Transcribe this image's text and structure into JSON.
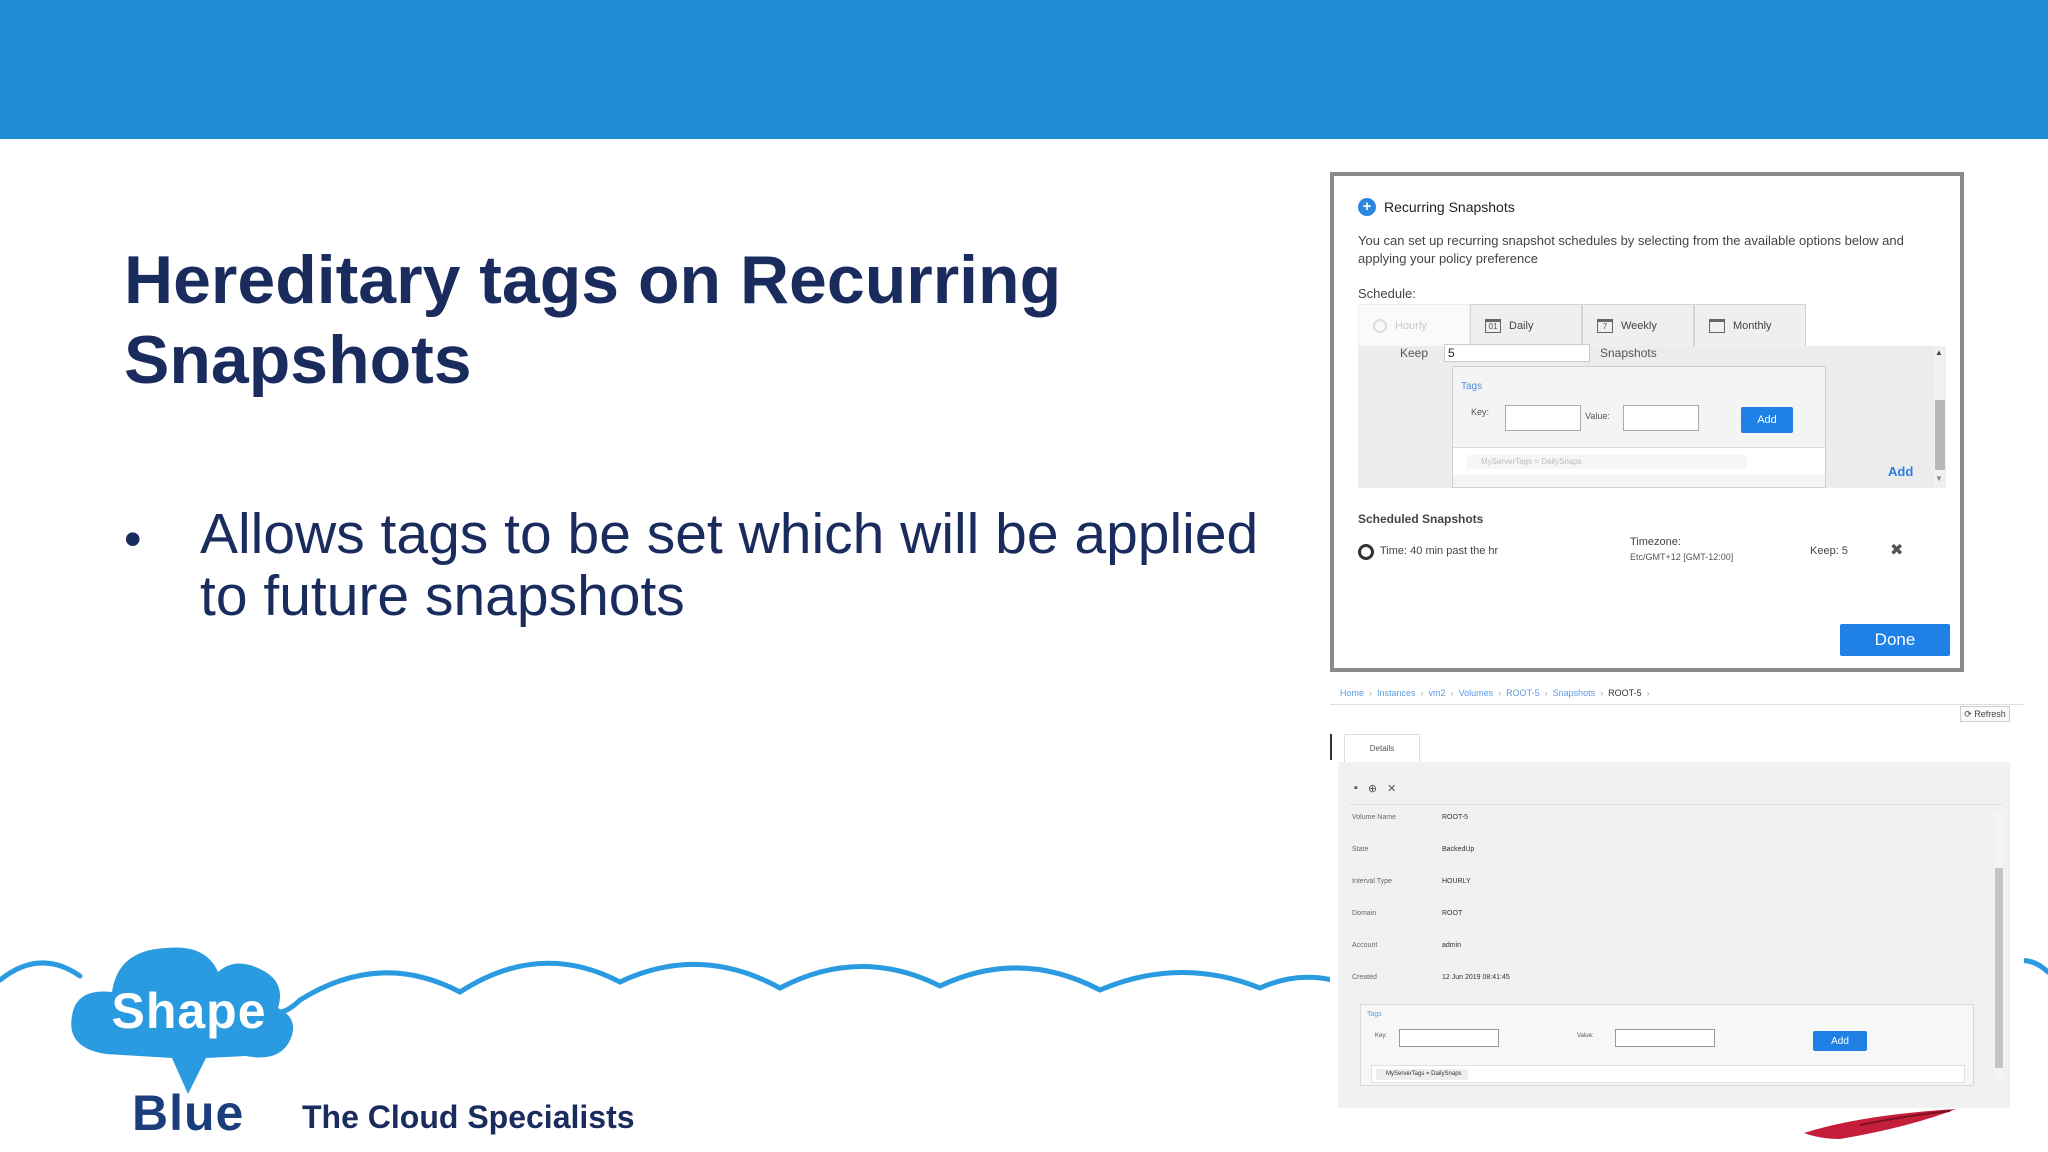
{
  "slide": {
    "title": "Hereditary tags on Recurring Snapshots",
    "bullet_symbol": "•",
    "bullet": "Allows tags to be set which will be applied to future snapshots"
  },
  "branding": {
    "logo_top": "Shape",
    "logo_bottom": "Blue",
    "tagline": "The Cloud Specialists",
    "colors": {
      "header": "#1e8cd2",
      "logo_cloud": "#2a9be0",
      "logo_text": "#1a3d7c",
      "title": "#1a2b5e"
    }
  },
  "dialog": {
    "title": "Recurring Snapshots",
    "description": "You can set up recurring snapshot schedules by selecting from the available options below and applying your policy preference",
    "schedule_label": "Schedule:",
    "tabs": [
      {
        "label": "Hourly",
        "icon": "clock-icon"
      },
      {
        "label": "Daily",
        "icon": "calendar-icon"
      },
      {
        "label": "Weekly",
        "icon": "calendar-icon"
      },
      {
        "label": "Monthly",
        "icon": "calendar-icon"
      }
    ],
    "keep_label": "Keep",
    "keep_value": "5",
    "keep_unit": "Snapshots",
    "tags": {
      "title": "Tags",
      "key_label": "Key:",
      "value_label": "Value:",
      "add_label": "Add",
      "chip": "MyServerTags = DailySnaps"
    },
    "panel_add_label": "Add",
    "scheduled_title": "Scheduled Snapshots",
    "scheduled": {
      "time": "Time: 40 min past the hr",
      "timezone_label": "Timezone:",
      "timezone_value": "Etc/GMT+12 [GMT-12:00]",
      "keep": "Keep: 5",
      "remove_icon": "✖"
    },
    "done_label": "Done"
  },
  "details": {
    "breadcrumbs": [
      "Home",
      "Instances",
      "vm2",
      "Volumes",
      "ROOT-5",
      "Snapshots",
      "ROOT-5"
    ],
    "refresh_label": "⟳ Refresh",
    "tab_label": "Details",
    "toolbar_icons": [
      "document-icon",
      "add-circle-icon",
      "close-icon"
    ],
    "rows": [
      {
        "label": "Volume Name",
        "value": "ROOT-5"
      },
      {
        "label": "State",
        "value": "BackedUp"
      },
      {
        "label": "Interval Type",
        "value": "HOURLY"
      },
      {
        "label": "Domain",
        "value": "ROOT"
      },
      {
        "label": "Account",
        "value": "admin"
      },
      {
        "label": "Created",
        "value": "12 Jun 2019 08:41:45"
      }
    ],
    "tags": {
      "title": "Tags",
      "key_label": "Key:",
      "value_label": "Value:",
      "add_label": "Add",
      "chip": "MyServerTags = DailySnaps"
    }
  }
}
